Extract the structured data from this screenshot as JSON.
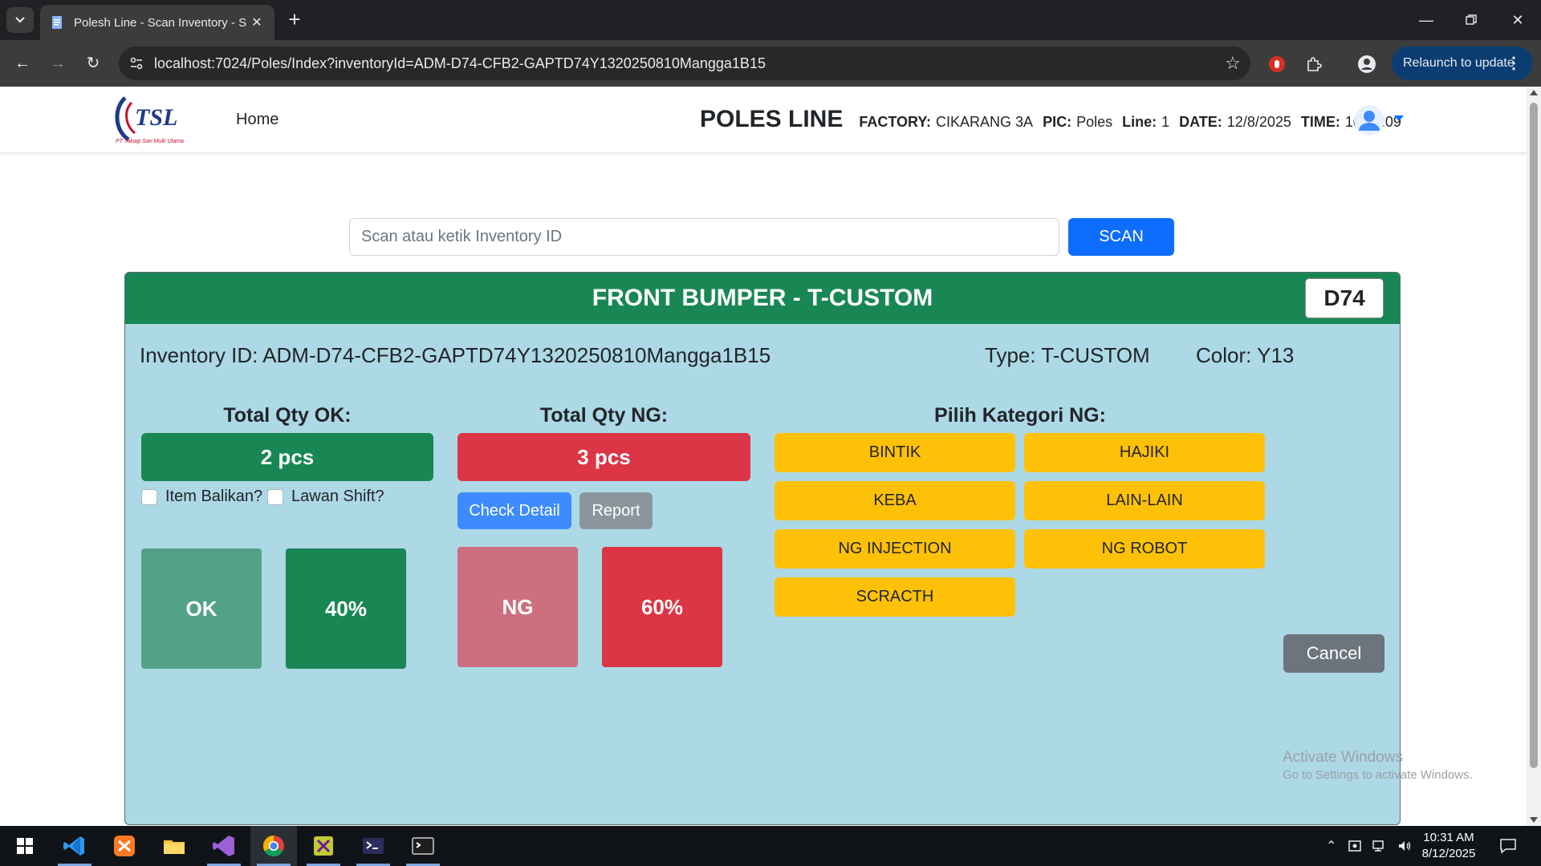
{
  "browser": {
    "tab_title": "Polesh Line - Scan Inventory - S",
    "url": "localhost:7024/Poles/Index?inventoryId=ADM-D74-CFB2-GAPTD74Y1320250810Mangga1B15",
    "relaunch_label": "Relaunch to update"
  },
  "navbar": {
    "home_label": "Home",
    "logo_text": "TSL",
    "logo_subtitle": "PT Takagi Sari Multi Utama",
    "title": "POLES LINE",
    "factory_label": "FACTORY:",
    "factory_value": "CIKARANG 3A",
    "pic_label": "PIC:",
    "pic_value": "Poles",
    "line_label": "Line:",
    "line_value": "1",
    "date_label": "DATE:",
    "date_value": "12/8/2025",
    "time_label": "TIME:",
    "time_value": "10.31.09"
  },
  "scan": {
    "placeholder": "Scan atau ketik Inventory ID",
    "button_label": "SCAN"
  },
  "card": {
    "header_title": "FRONT BUMPER - T-CUSTOM",
    "code": "D74",
    "inventory_id_text": "Inventory ID: ADM-D74-CFB2-GAPTD74Y1320250810Mangga1B15",
    "type_text": "Type: T-CUSTOM",
    "color_text": "Color: Y13",
    "ok": {
      "label": "Total Qty OK:",
      "qty": "2 pcs",
      "tile_label": "OK",
      "percent": "40%"
    },
    "ng": {
      "label": "Total Qty NG:",
      "qty": "3 pcs",
      "tile_label": "NG",
      "percent": "60%"
    },
    "checkbox_balikan": "Item Balikan?",
    "checkbox_lawan_shift": "Lawan Shift?",
    "check_detail_label": "Check Detail",
    "report_label": "Report",
    "ng_category_title": "Pilih Kategori NG:",
    "ng_categories": [
      "BINTIK",
      "HAJIKI",
      "KEBA",
      "LAIN-LAIN",
      "NG INJECTION",
      "NG ROBOT",
      "SCRACTH"
    ],
    "cancel_label": "Cancel"
  },
  "watermark": {
    "line1": "Activate Windows",
    "line2": "Go to Settings to activate Windows."
  },
  "taskbar": {
    "time": "10:31 AM",
    "date": "8/12/2025"
  },
  "colors": {
    "success": "#198754",
    "danger": "#dc3545",
    "warning": "#ffc107",
    "primary": "#0d6efd",
    "card_bg": "#add8e6",
    "secondary": "#6c757d"
  }
}
